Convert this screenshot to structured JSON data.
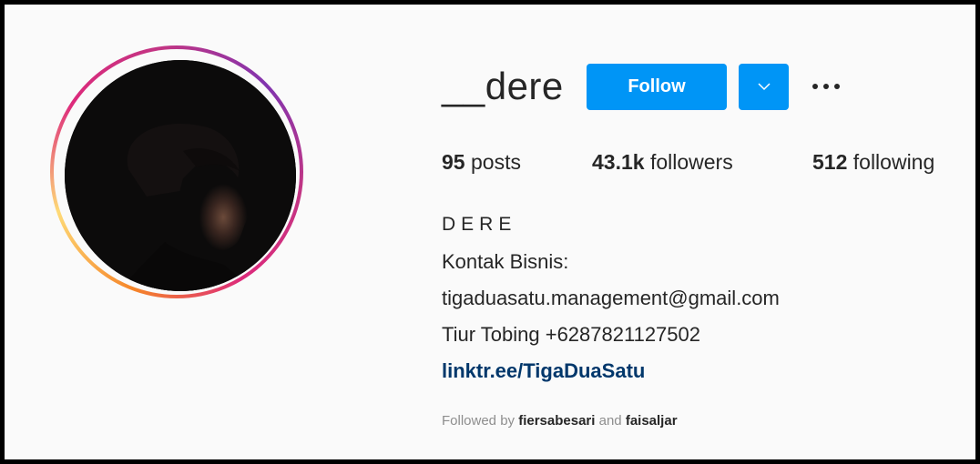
{
  "profile": {
    "username": "__dere",
    "follow_label": "Follow",
    "dropdown_icon": "chevron-down-icon",
    "more_icon": "more-options-icon"
  },
  "stats": {
    "posts_count": "95",
    "posts_label": " posts",
    "followers_count": "43.1k",
    "followers_label": " followers",
    "following_count": "512",
    "following_label": " following"
  },
  "bio": {
    "full_name": "DERE",
    "line1": "Kontak Bisnis:",
    "line2": "tigaduasatu.management@gmail.com",
    "line3": "Tiur Tobing +6287821127502",
    "link": "linktr.ee/TigaDuaSatu"
  },
  "followed_by": {
    "prefix": "Followed by ",
    "user1": "fiersabesari",
    "conj": " and ",
    "user2": "faisaljar"
  },
  "colors": {
    "accent": "#0095f6",
    "link": "#00376b",
    "text": "#262626",
    "muted": "#8e8e8e",
    "background": "#fafafa"
  }
}
